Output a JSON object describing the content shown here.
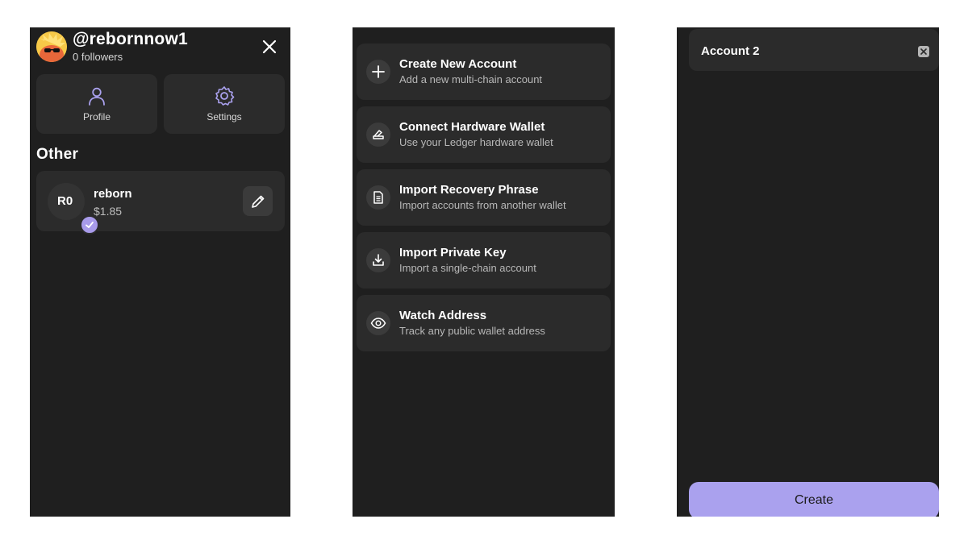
{
  "colors": {
    "panel_bg": "#1f1f1f",
    "card_bg": "#2b2b2b",
    "accent": "#aaa1ee",
    "text_primary": "#ffffff",
    "text_secondary": "#b8b8b8"
  },
  "profile_panel": {
    "username": "@rebornnow1",
    "followers": "0 followers",
    "close_icon": "close-icon",
    "tiles": [
      {
        "label": "Profile",
        "icon": "user-icon"
      },
      {
        "label": "Settings",
        "icon": "gear-icon"
      }
    ],
    "section_title": "Other",
    "account": {
      "initials": "R0",
      "name": "reborn",
      "balance": "$1.85",
      "edit_icon": "pencil-icon"
    }
  },
  "add_account_panel": {
    "options": [
      {
        "title": "Create New Account",
        "subtitle": "Add a new multi-chain account",
        "icon": "plus-icon"
      },
      {
        "title": "Connect Hardware Wallet",
        "subtitle": "Use your Ledger hardware wallet",
        "icon": "hardware-wallet-icon"
      },
      {
        "title": "Import Recovery Phrase",
        "subtitle": "Import accounts from another wallet",
        "icon": "document-icon"
      },
      {
        "title": "Import Private Key",
        "subtitle": "Import a single-chain account",
        "icon": "download-icon"
      },
      {
        "title": "Watch Address",
        "subtitle": "Track any public wallet address",
        "icon": "eye-icon"
      }
    ]
  },
  "create_panel": {
    "account_name_value": "Account 2",
    "clear_icon": "clear-icon",
    "create_label": "Create"
  }
}
